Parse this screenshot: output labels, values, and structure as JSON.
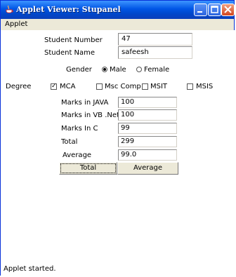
{
  "window": {
    "title": "Applet Viewer: Stupanel"
  },
  "menu": {
    "applet": "Applet"
  },
  "form": {
    "student_number_label": "Student Number",
    "student_number_value": "47",
    "student_name_label": "Student Name",
    "student_name_value": "safeesh",
    "gender_label": "Gender",
    "gender_options": {
      "male": "Male",
      "female": "Female"
    },
    "gender_selected": "Male",
    "degree_label": "Degree",
    "degree_options": {
      "mca": "MCA",
      "msc": "Msc Comp",
      "msit": "MSIT",
      "msis": "MSIS"
    },
    "degree_checked": [
      "MCA"
    ],
    "java_label": "Marks in JAVA",
    "java_value": "100",
    "vb_label": "Marks in VB .Net",
    "vb_value": "100",
    "c_label": "Marks In C",
    "c_value": "99",
    "total_label": "Total",
    "total_value": "299",
    "average_label": "Average",
    "average_value": "99.0"
  },
  "buttons": {
    "total": "Total",
    "average": "Average"
  },
  "status": {
    "text": "Applet started."
  }
}
